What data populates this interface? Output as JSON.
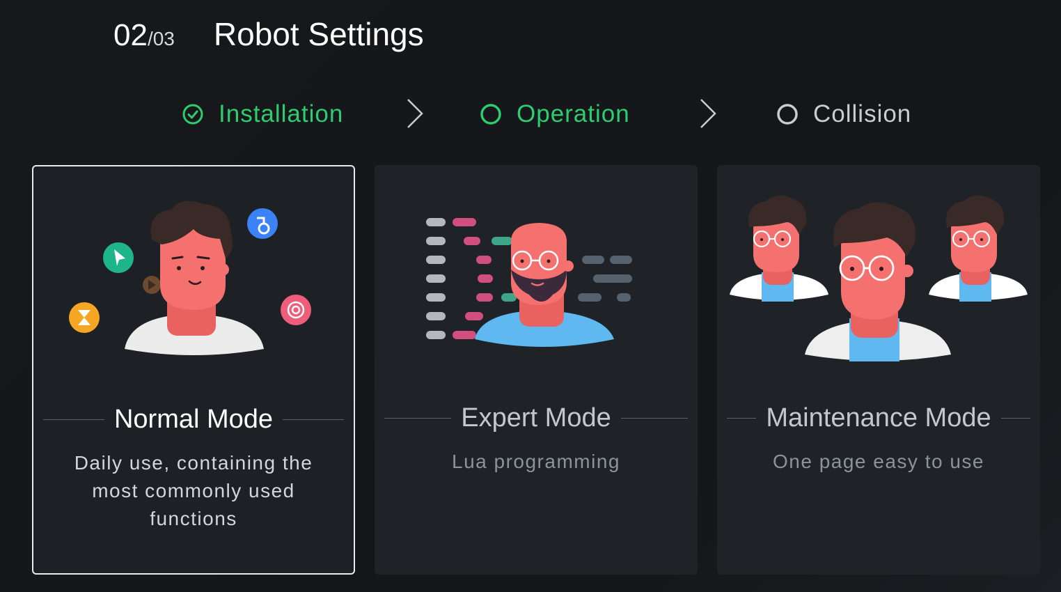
{
  "header": {
    "step_current": "02",
    "step_total": "/03",
    "title": "Robot Settings"
  },
  "stepper": {
    "steps": [
      {
        "label": "Installation",
        "state": "completed",
        "icon": "check-circle-icon"
      },
      {
        "label": "Operation",
        "state": "current",
        "icon": "ring-icon"
      },
      {
        "label": "Collision",
        "state": "pending",
        "icon": "ring-icon"
      }
    ],
    "separator_icon": "chevron-right-icon"
  },
  "modes": [
    {
      "title": "Normal Mode",
      "description": "Daily use, containing the most commonly used functions",
      "selected": true
    },
    {
      "title": "Expert Mode",
      "description": "Lua programming",
      "selected": false
    },
    {
      "title": "Maintenance Mode",
      "description": "One page easy to use",
      "selected": false
    }
  ],
  "colors": {
    "accent_green": "#2ecc71",
    "card_bg": "#1f2226",
    "selected_border": "#e8eaec",
    "skin": "#f4716f",
    "hair": "#3a2a27",
    "shirt_blue": "#5fb8ef"
  }
}
